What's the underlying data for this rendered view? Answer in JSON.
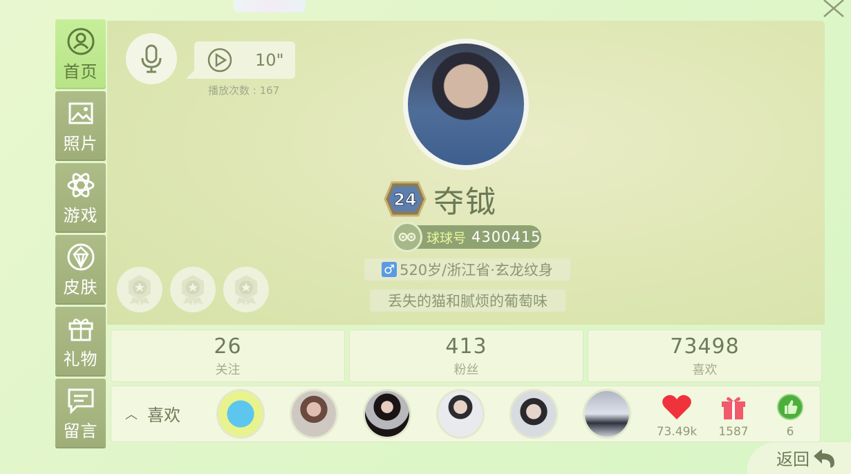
{
  "sidebar": {
    "items": [
      {
        "label": "首页",
        "icon": "home-user-icon"
      },
      {
        "label": "照片",
        "icon": "photo-icon"
      },
      {
        "label": "游戏",
        "icon": "atom-icon"
      },
      {
        "label": "皮肤",
        "icon": "diamond-icon"
      },
      {
        "label": "礼物",
        "icon": "gift-icon"
      },
      {
        "label": "留言",
        "icon": "message-icon"
      }
    ]
  },
  "voice": {
    "duration": "10\"",
    "play_count": "播放次数 : 167"
  },
  "profile": {
    "level": "24",
    "name": "夺钺",
    "id_label": "球球号",
    "id_value": "4300415",
    "gender_symbol": "♂",
    "info": "520岁/浙江省·玄龙纹身",
    "signature": "丢失的猫和腻烦的葡萄味"
  },
  "stats": [
    {
      "value": "26",
      "label": "关注"
    },
    {
      "value": "413",
      "label": "粉丝"
    },
    {
      "value": "73498",
      "label": "喜欢"
    }
  ],
  "likes": {
    "toggle_label": "喜欢",
    "hearts": "73.49k",
    "gifts": "1587",
    "thumbs": "6"
  },
  "back_label": "返回",
  "colors": {
    "accent": "#b7e486",
    "heart": "#f0323c",
    "gift": "#f05a6a",
    "thumb": "#4caf3b"
  }
}
